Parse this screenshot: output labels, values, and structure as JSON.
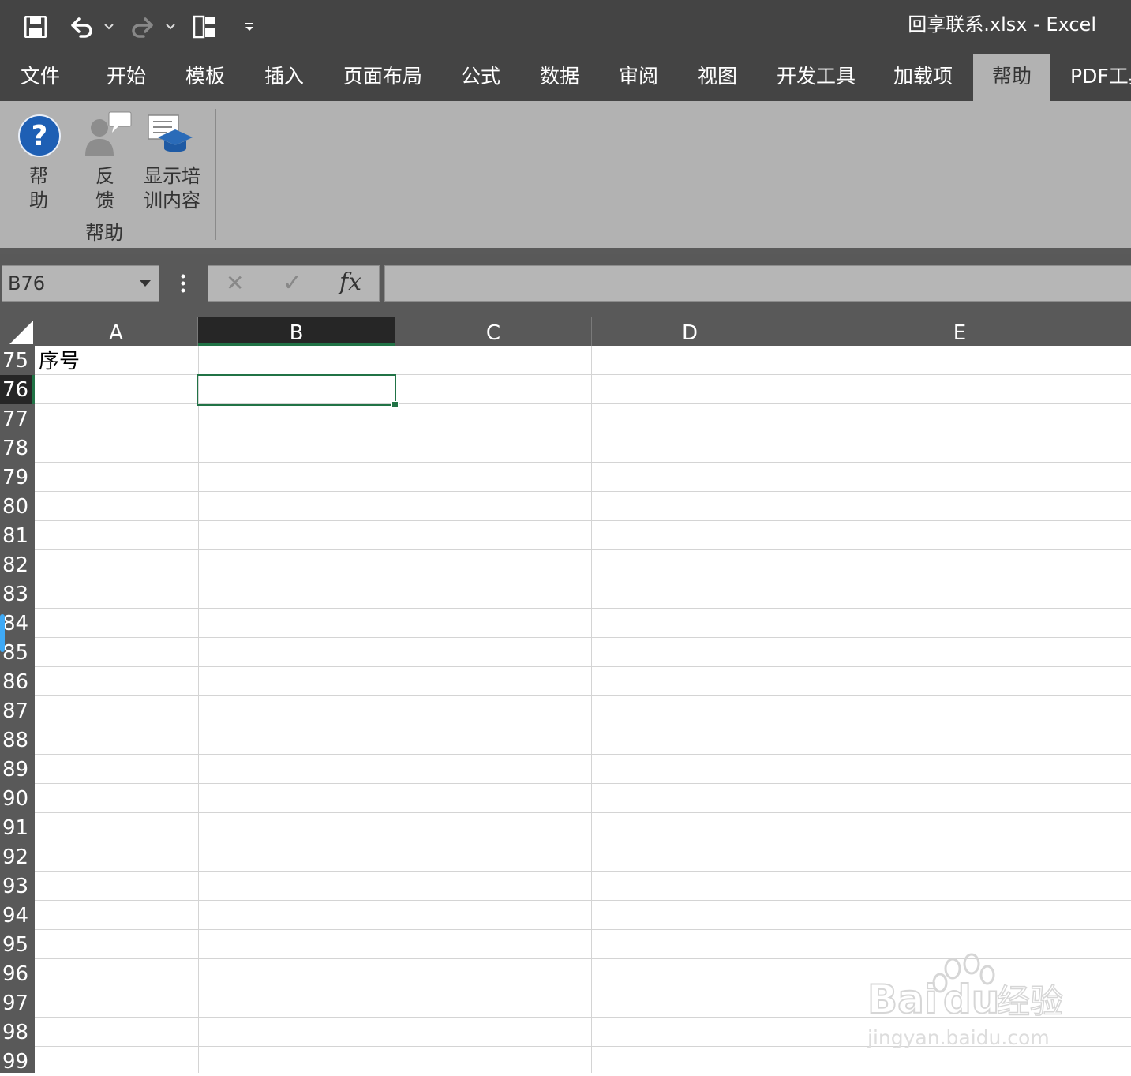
{
  "window": {
    "title": "回享联系.xlsx  -  Excel"
  },
  "quick_access": {
    "icons": [
      "save-icon",
      "undo-icon",
      "dropdown-icon",
      "redo-icon",
      "dropdown-icon",
      "layout-icon",
      "customize-icon"
    ]
  },
  "ribbon": {
    "tabs": [
      {
        "label": "文件"
      },
      {
        "label": "开始"
      },
      {
        "label": "模板"
      },
      {
        "label": "插入"
      },
      {
        "label": "页面布局"
      },
      {
        "label": "公式"
      },
      {
        "label": "数据"
      },
      {
        "label": "审阅"
      },
      {
        "label": "视图"
      },
      {
        "label": "开发工具"
      },
      {
        "label": "加载项"
      },
      {
        "label": "帮助",
        "active": true
      },
      {
        "label": "PDF工具"
      }
    ],
    "buttons": [
      {
        "label_line1": "帮",
        "label_line2": "助",
        "icon": "help-icon"
      },
      {
        "label_line1": "反",
        "label_line2": "馈",
        "icon": "feedback-icon"
      },
      {
        "label_line1": "显示培",
        "label_line2": "训内容",
        "icon": "training-icon"
      }
    ],
    "group_label": "帮助"
  },
  "formula_bar": {
    "name_box": "B76",
    "cancel_symbol": "✕",
    "enter_symbol": "✓",
    "fx_label": "fx",
    "formula": ""
  },
  "grid": {
    "columns": [
      "A",
      "B",
      "C",
      "D",
      "E"
    ],
    "selected_column": "B",
    "rows": [
      "75",
      "76",
      "77",
      "78",
      "79",
      "80",
      "81",
      "82",
      "83",
      "84",
      "85",
      "86",
      "87",
      "88",
      "89",
      "90",
      "91",
      "92",
      "93",
      "94",
      "95",
      "96",
      "97",
      "98",
      "99"
    ],
    "selected_row": "76",
    "cells": {
      "A75": "序号"
    }
  },
  "colors": {
    "title_bar": "#444444",
    "ribbon": "#b2b2b2",
    "header_bg": "#595959",
    "selection": "#217346",
    "scroll_accent": "#3fa9f5"
  },
  "watermark": {
    "brand": "Baidu经验",
    "url": "jingyan.baidu.com"
  }
}
